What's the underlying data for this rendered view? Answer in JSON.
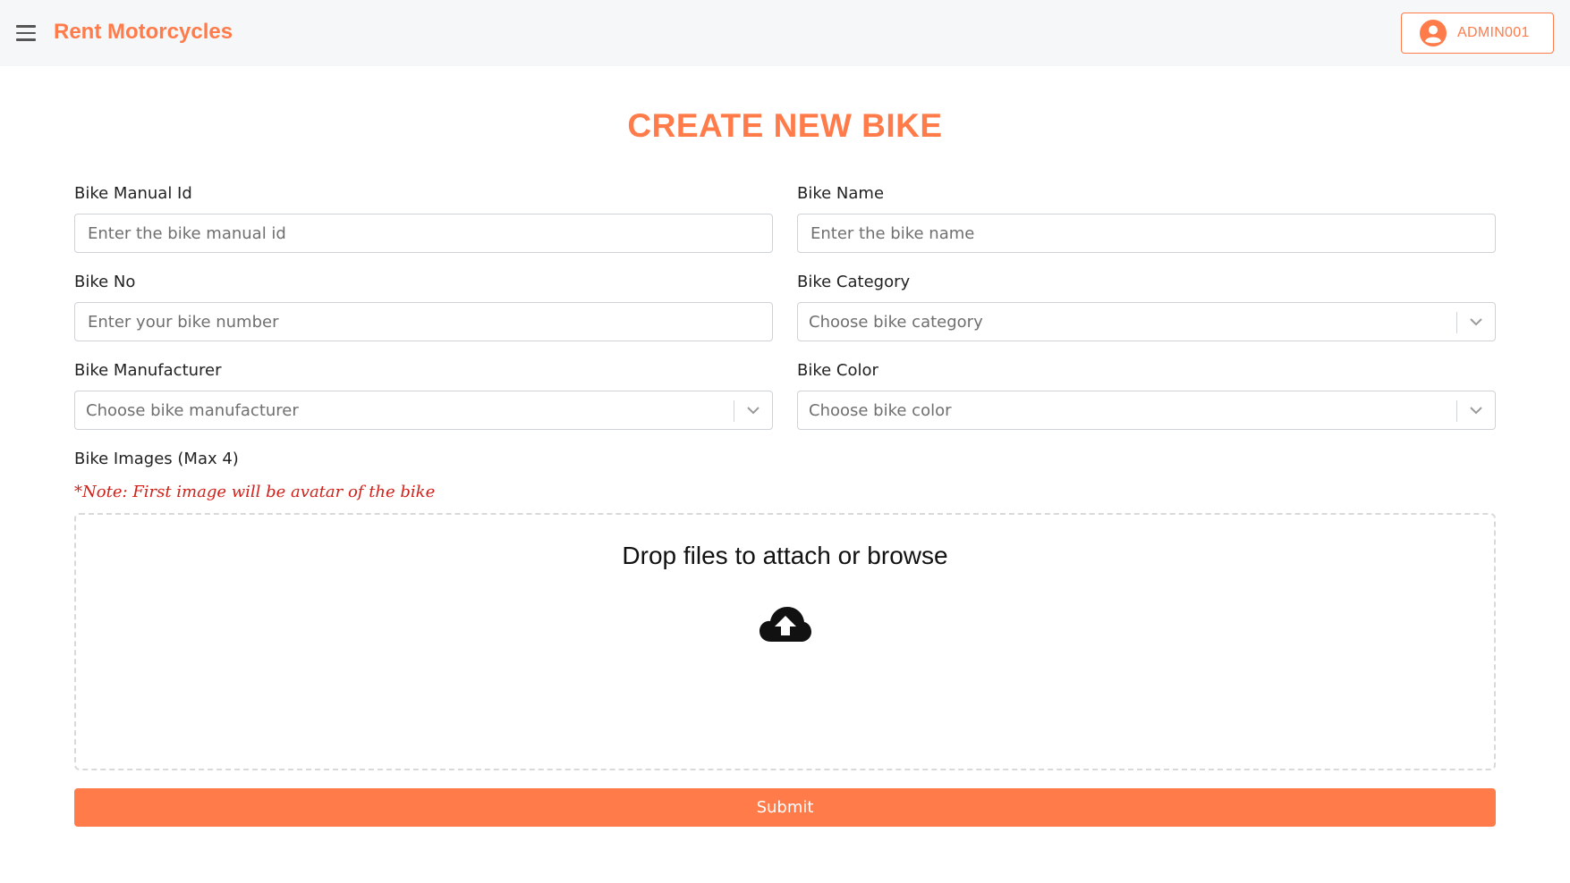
{
  "header": {
    "brand": "Rent Motorcycles",
    "user": "ADMIN001"
  },
  "page": {
    "title": "CREATE NEW BIKE"
  },
  "form": {
    "manual_id": {
      "label": "Bike Manual Id",
      "placeholder": "Enter the bike manual id",
      "value": ""
    },
    "bike_name": {
      "label": "Bike Name",
      "placeholder": "Enter the bike name",
      "value": ""
    },
    "bike_no": {
      "label": "Bike No",
      "placeholder": "Enter your bike number",
      "value": ""
    },
    "category": {
      "label": "Bike Category",
      "placeholder": "Choose bike category"
    },
    "manufacturer": {
      "label": "Bike Manufacturer",
      "placeholder": "Choose bike manufacturer"
    },
    "color": {
      "label": "Bike Color",
      "placeholder": "Choose bike color"
    },
    "images": {
      "label": "Bike Images (Max 4)",
      "note": "*Note: First image will be avatar of the bike",
      "dropzone_text": "Drop files to attach or browse"
    },
    "submit_label": "Submit"
  },
  "colors": {
    "accent": "#ff7b4a",
    "note": "#d0211a"
  },
  "icons": {
    "menu": "hamburger-menu-icon",
    "user": "user-circle-icon",
    "chevron": "chevron-down-icon",
    "upload": "cloud-upload-icon"
  }
}
